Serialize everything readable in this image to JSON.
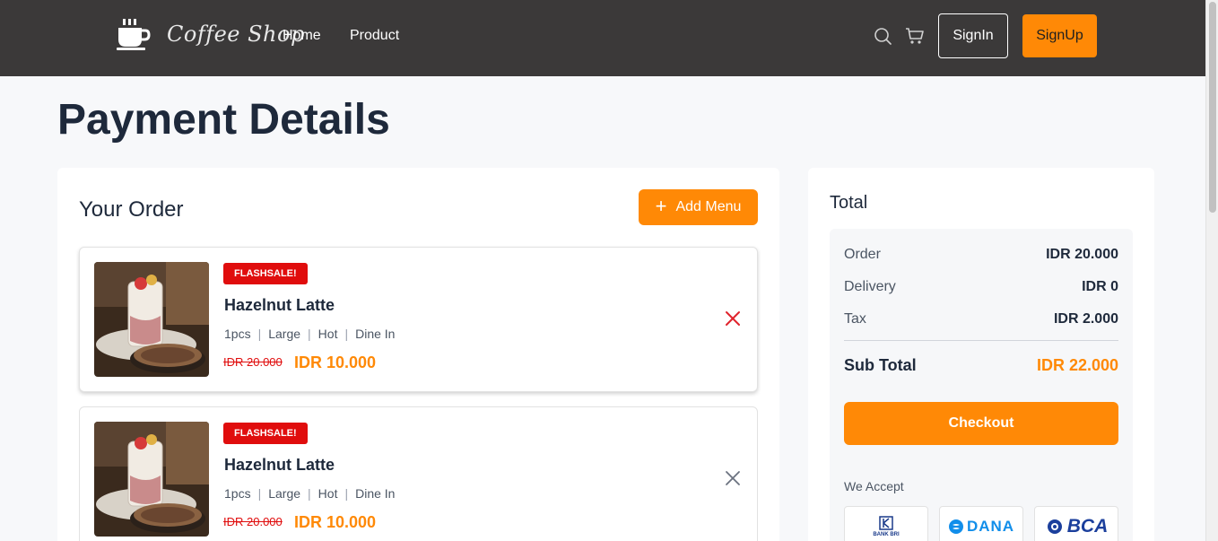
{
  "header": {
    "logo_text": "Coffee Shop",
    "nav": [
      {
        "label": "Home"
      },
      {
        "label": "Product"
      }
    ],
    "signin_label": "SignIn",
    "signup_label": "SignUp"
  },
  "page": {
    "title": "Payment Details"
  },
  "order": {
    "title": "Your Order",
    "add_menu_label": "Add Menu",
    "items": [
      {
        "badge": "FLASHSALE!",
        "name": "Hazelnut Latte",
        "qty": "1pcs",
        "size": "Large",
        "temp": "Hot",
        "service": "Dine In",
        "price_old": "IDR 20.000",
        "price_new": "IDR 10.000"
      },
      {
        "badge": "FLASHSALE!",
        "name": "Hazelnut Latte",
        "qty": "1pcs",
        "size": "Large",
        "temp": "Hot",
        "service": "Dine In",
        "price_old": "IDR 20.000",
        "price_new": "IDR 10.000"
      }
    ]
  },
  "total": {
    "title": "Total",
    "rows": [
      {
        "label": "Order",
        "value": "IDR 20.000"
      },
      {
        "label": "Delivery",
        "value": "IDR 0"
      },
      {
        "label": "Tax",
        "value": "IDR 2.000"
      }
    ],
    "subtotal_label": "Sub Total",
    "subtotal_value": "IDR 22.000",
    "checkout_label": "Checkout",
    "accept_label": "We Accept",
    "payment_methods": [
      {
        "name": "BANK BRI"
      },
      {
        "name": "DANA"
      },
      {
        "name": "BCA"
      }
    ]
  },
  "colors": {
    "accent": "#ff8906",
    "header_bg": "#3b3939",
    "flashsale": "#e00d0d",
    "remove_active": "#e0242d",
    "remove_inactive": "#6b7280"
  }
}
